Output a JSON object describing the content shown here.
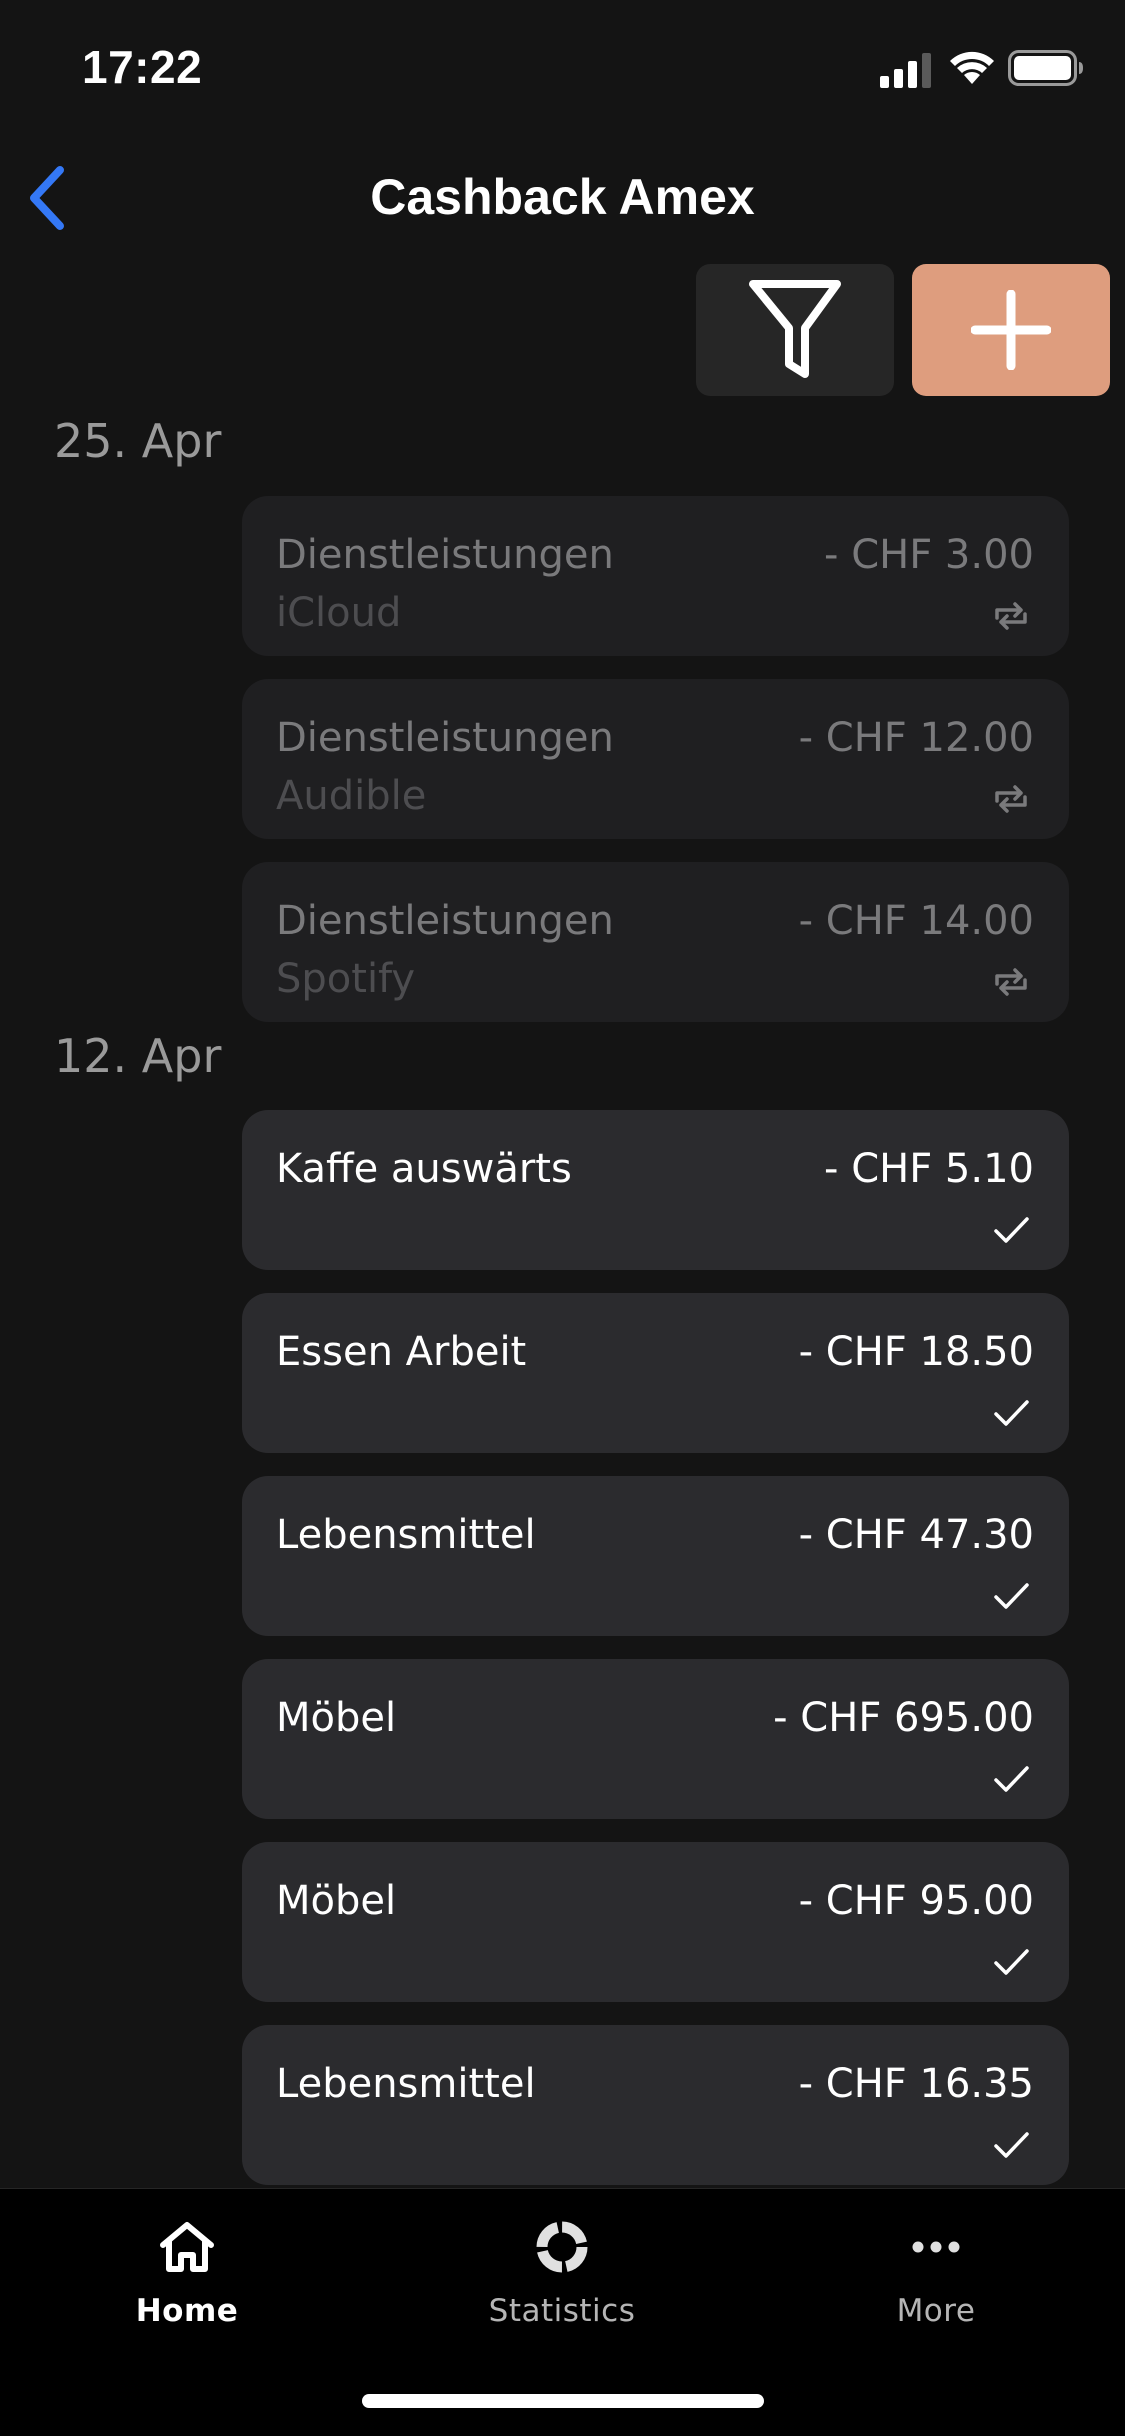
{
  "status_bar": {
    "time": "17:22"
  },
  "header": {
    "title": "Cashback Amex",
    "back_icon": "chevron-left-icon"
  },
  "toolbar": {
    "filter_icon": "filter-icon",
    "add_icon": "plus-icon"
  },
  "colors": {
    "accent": "#3478f6",
    "add_button": "#de9d7e",
    "card": "#2b2b2e",
    "card_pending": "#1f1f21",
    "background": "#141414"
  },
  "groups": [
    {
      "date": "25. Apr",
      "transactions": [
        {
          "category": "Dienstleistungen",
          "amount": "- CHF 3.00",
          "note": "iCloud",
          "status": "recurring-icon"
        },
        {
          "category": "Dienstleistungen",
          "amount": "- CHF 12.00",
          "note": "Audible",
          "status": "recurring-icon"
        },
        {
          "category": "Dienstleistungen",
          "amount": "- CHF 14.00",
          "note": "Spotify",
          "status": "recurring-icon"
        }
      ]
    },
    {
      "date": "12. Apr",
      "transactions": [
        {
          "category": "Kaffe auswärts",
          "amount": "- CHF 5.10",
          "status": "checkmark-icon"
        },
        {
          "category": "Essen Arbeit",
          "amount": "- CHF 18.50",
          "status": "checkmark-icon"
        },
        {
          "category": "Lebensmittel",
          "amount": "- CHF 47.30",
          "status": "checkmark-icon"
        },
        {
          "category": "Möbel",
          "amount": "- CHF 695.00",
          "status": "checkmark-icon"
        },
        {
          "category": "Möbel",
          "amount": "- CHF 95.00",
          "status": "checkmark-icon"
        },
        {
          "category": "Lebensmittel",
          "amount": "- CHF 16.35",
          "status": "checkmark-icon"
        }
      ]
    }
  ],
  "tab_bar": {
    "tabs": [
      {
        "label": "Home",
        "icon": "home-icon",
        "active": true
      },
      {
        "label": "Statistics",
        "icon": "statistics-icon",
        "active": false
      },
      {
        "label": "More",
        "icon": "more-icon",
        "active": false
      }
    ]
  }
}
